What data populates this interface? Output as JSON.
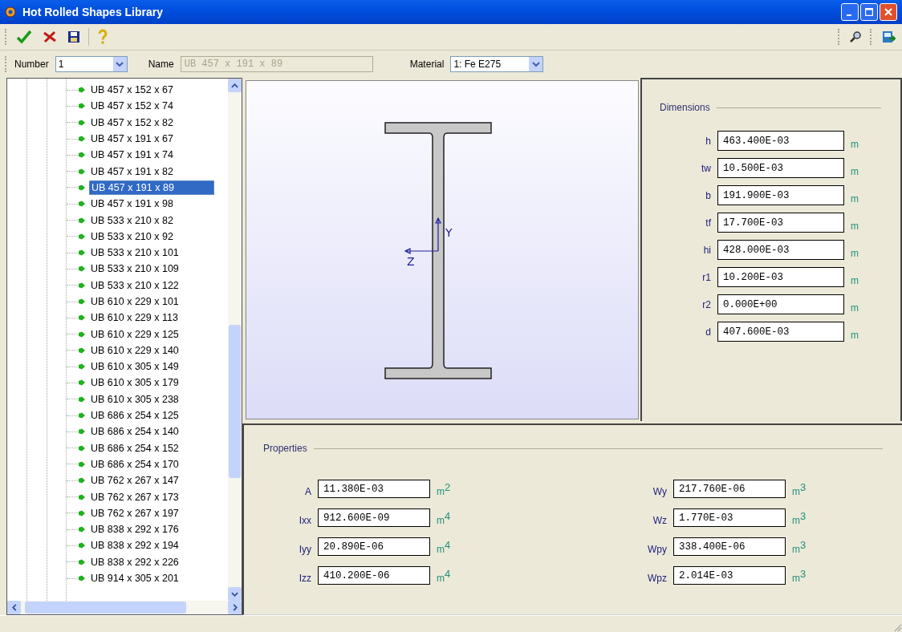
{
  "window": {
    "title": "Hot Rolled Shapes Library"
  },
  "fields": {
    "number_label": "Number",
    "number": "1",
    "name_label": "Name",
    "name": "UB 457 x 191 x 89",
    "name_disabled": true,
    "material_label": "Material",
    "material": "1: Fe E275"
  },
  "tree": {
    "items": [
      {
        "label": "UB 457 x 152 x 67",
        "selected": false
      },
      {
        "label": "UB 457 x 152 x 74",
        "selected": false
      },
      {
        "label": "UB 457 x 152 x 82",
        "selected": false
      },
      {
        "label": "UB 457 x 191 x 67",
        "selected": false
      },
      {
        "label": "UB 457 x 191 x 74",
        "selected": false
      },
      {
        "label": "UB 457 x 191 x 82",
        "selected": false
      },
      {
        "label": "UB 457 x 191 x 89",
        "selected": true
      },
      {
        "label": "UB 457 x 191 x 98",
        "selected": false
      },
      {
        "label": "UB 533 x 210 x 82",
        "selected": false
      },
      {
        "label": "UB 533 x 210 x 92",
        "selected": false
      },
      {
        "label": "UB 533 x 210 x 101",
        "selected": false
      },
      {
        "label": "UB 533 x 210 x 109",
        "selected": false
      },
      {
        "label": "UB 533 x 210 x 122",
        "selected": false
      },
      {
        "label": "UB 610 x 229 x 101",
        "selected": false
      },
      {
        "label": "UB 610 x 229 x 113",
        "selected": false
      },
      {
        "label": "UB 610 x 229 x 125",
        "selected": false
      },
      {
        "label": "UB 610 x 229 x 140",
        "selected": false
      },
      {
        "label": "UB 610 x 305 x 149",
        "selected": false
      },
      {
        "label": "UB 610 x 305 x 179",
        "selected": false
      },
      {
        "label": "UB 610 x 305 x 238",
        "selected": false
      },
      {
        "label": "UB 686 x 254 x 125",
        "selected": false
      },
      {
        "label": "UB 686 x 254 x 140",
        "selected": false
      },
      {
        "label": "UB 686 x 254 x 152",
        "selected": false
      },
      {
        "label": "UB 686 x 254 x 170",
        "selected": false
      },
      {
        "label": "UB 762 x 267 x 147",
        "selected": false
      },
      {
        "label": "UB 762 x 267 x 173",
        "selected": false
      },
      {
        "label": "UB 762 x 267 x 197",
        "selected": false
      },
      {
        "label": "UB 838 x 292 x 176",
        "selected": false
      },
      {
        "label": "UB 838 x 292 x 194",
        "selected": false
      },
      {
        "label": "UB 838 x 292 x 226",
        "selected": false
      },
      {
        "label": "UB 914 x 305 x 201",
        "selected": false
      }
    ]
  },
  "drawing": {
    "y_label": "Y",
    "z_label": "Z"
  },
  "dimensions": {
    "title": "Dimensions",
    "rows": [
      {
        "label": "h",
        "value": "463.400E-03",
        "unit": "m"
      },
      {
        "label": "tw",
        "value": "10.500E-03",
        "unit": "m"
      },
      {
        "label": "b",
        "value": "191.900E-03",
        "unit": "m"
      },
      {
        "label": "tf",
        "value": "17.700E-03",
        "unit": "m"
      },
      {
        "label": "hi",
        "value": "428.000E-03",
        "unit": "m"
      },
      {
        "label": "r1",
        "value": "10.200E-03",
        "unit": "m"
      },
      {
        "label": "r2",
        "value": "0.000E+00",
        "unit": "m"
      },
      {
        "label": "d",
        "value": "407.600E-03",
        "unit": "m"
      }
    ]
  },
  "properties": {
    "title": "Properties",
    "left": [
      {
        "label": "A",
        "value": "11.380E-03",
        "unit": "m$^{2}$"
      },
      {
        "label": "Ixx",
        "value": "912.600E-09",
        "unit": "m$^{4}$"
      },
      {
        "label": "Iyy",
        "value": "20.890E-06",
        "unit": "m$^{4}$"
      },
      {
        "label": "Izz",
        "value": "410.200E-06",
        "unit": "m$^{4}$"
      }
    ],
    "right": [
      {
        "label": "Wy",
        "value": "217.760E-06",
        "unit": "m$^{3}$"
      },
      {
        "label": "Wz",
        "value": "1.770E-03",
        "unit": "m$^{3}$"
      },
      {
        "label": "Wpy",
        "value": "338.400E-06",
        "unit": "m$^{3}$"
      },
      {
        "label": "Wpz",
        "value": "2.014E-03",
        "unit": "m$^{3}$"
      }
    ]
  }
}
